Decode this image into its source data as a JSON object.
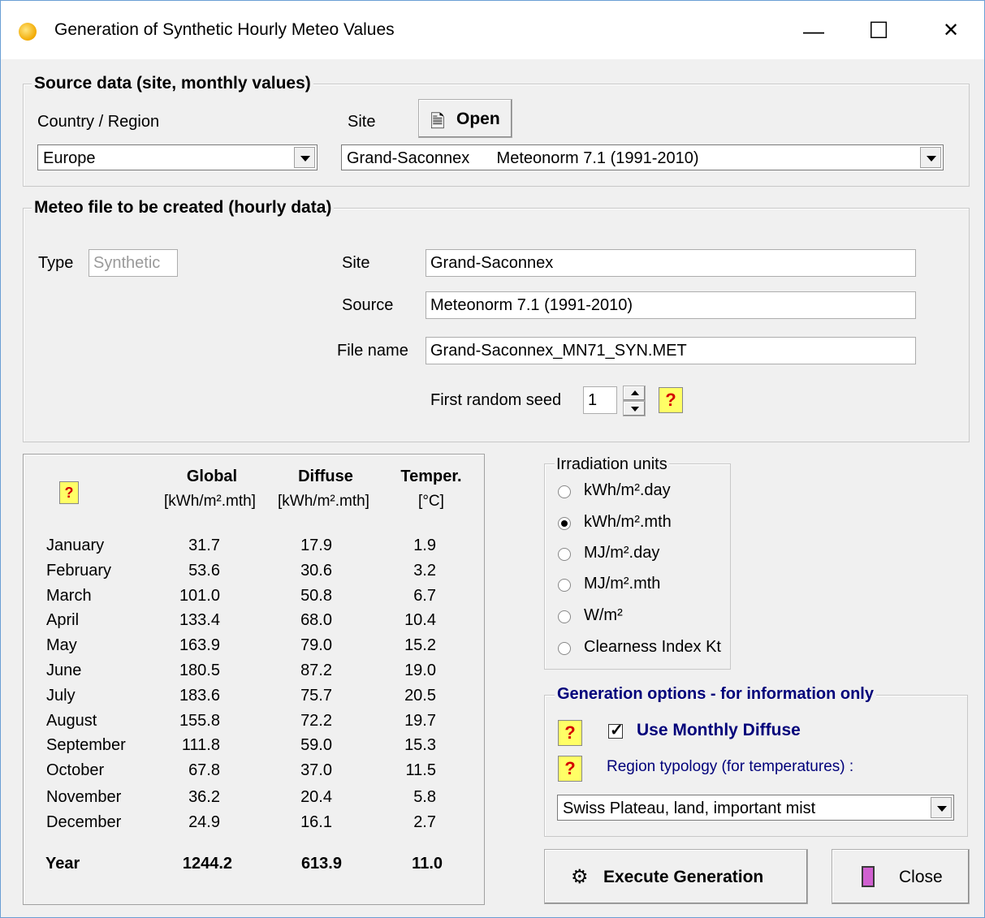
{
  "window": {
    "title": "Generation of Synthetic Hourly Meteo Values",
    "minimize": "—",
    "maximize": "☐",
    "close": "✕"
  },
  "source": {
    "group_label": "Source data  (site, monthly values)",
    "country_label": "Country / Region",
    "country_value": "Europe",
    "site_label": "Site",
    "open_label": "Open",
    "site_value": "Grand-Saconnex      Meteonorm 7.1 (1991-2010)"
  },
  "meteo": {
    "group_label": "Meteo file to be created (hourly data)",
    "type_label": "Type",
    "type_value": "Synthetic",
    "site_label": "Site",
    "site_value": "Grand-Saconnex",
    "source_label": "Source",
    "source_value": "Meteonorm 7.1 (1991-2010)",
    "filename_label": "File name",
    "filename_value": "Grand-Saconnex_MN71_SYN.MET",
    "seed_label": "First random seed",
    "seed_value": "1"
  },
  "table": {
    "columns": [
      {
        "title": "Global",
        "unit": "[kWh/m².mth]"
      },
      {
        "title": "Diffuse",
        "unit": "[kWh/m².mth]"
      },
      {
        "title": "Temper.",
        "unit": "[°C]"
      }
    ],
    "rows": [
      {
        "month": "January",
        "global": "31.7",
        "diffuse": "17.9",
        "temp": "1.9"
      },
      {
        "month": "February",
        "global": "53.6",
        "diffuse": "30.6",
        "temp": "3.2"
      },
      {
        "month": "March",
        "global": "101.0",
        "diffuse": "50.8",
        "temp": "6.7"
      },
      {
        "month": "April",
        "global": "133.4",
        "diffuse": "68.0",
        "temp": "10.4"
      },
      {
        "month": "May",
        "global": "163.9",
        "diffuse": "79.0",
        "temp": "15.2"
      },
      {
        "month": "June",
        "global": "180.5",
        "diffuse": "87.2",
        "temp": "19.0"
      },
      {
        "month": "July",
        "global": "183.6",
        "diffuse": "75.7",
        "temp": "20.5"
      },
      {
        "month": "August",
        "global": "155.8",
        "diffuse": "72.2",
        "temp": "19.7"
      },
      {
        "month": "September",
        "global": "111.8",
        "diffuse": "59.0",
        "temp": "15.3"
      },
      {
        "month": "October",
        "global": "67.8",
        "diffuse": "37.0",
        "temp": "11.5"
      },
      {
        "month": "November",
        "global": "36.2",
        "diffuse": "20.4",
        "temp": "5.8"
      },
      {
        "month": "December",
        "global": "24.9",
        "diffuse": "16.1",
        "temp": "2.7"
      }
    ],
    "year": {
      "month": "Year",
      "global": "1244.2",
      "diffuse": "613.9",
      "temp": "11.0"
    }
  },
  "units": {
    "group_label": "Irradiation units",
    "options": [
      "kWh/m².day",
      "kWh/m².mth",
      "MJ/m².day",
      "MJ/m².mth",
      "W/m²",
      "Clearness Index Kt"
    ],
    "selected_index": 1
  },
  "options": {
    "group_label": "Generation options - for information only",
    "use_monthly_diffuse": "Use Monthly Diffuse",
    "use_monthly_diffuse_checked": true,
    "region_label": "Region typology  (for temperatures) :",
    "region_value": "Swiss Plateau, land, important mist",
    "help_glyph": "?"
  },
  "actions": {
    "execute": "Execute Generation",
    "close": "Close"
  }
}
